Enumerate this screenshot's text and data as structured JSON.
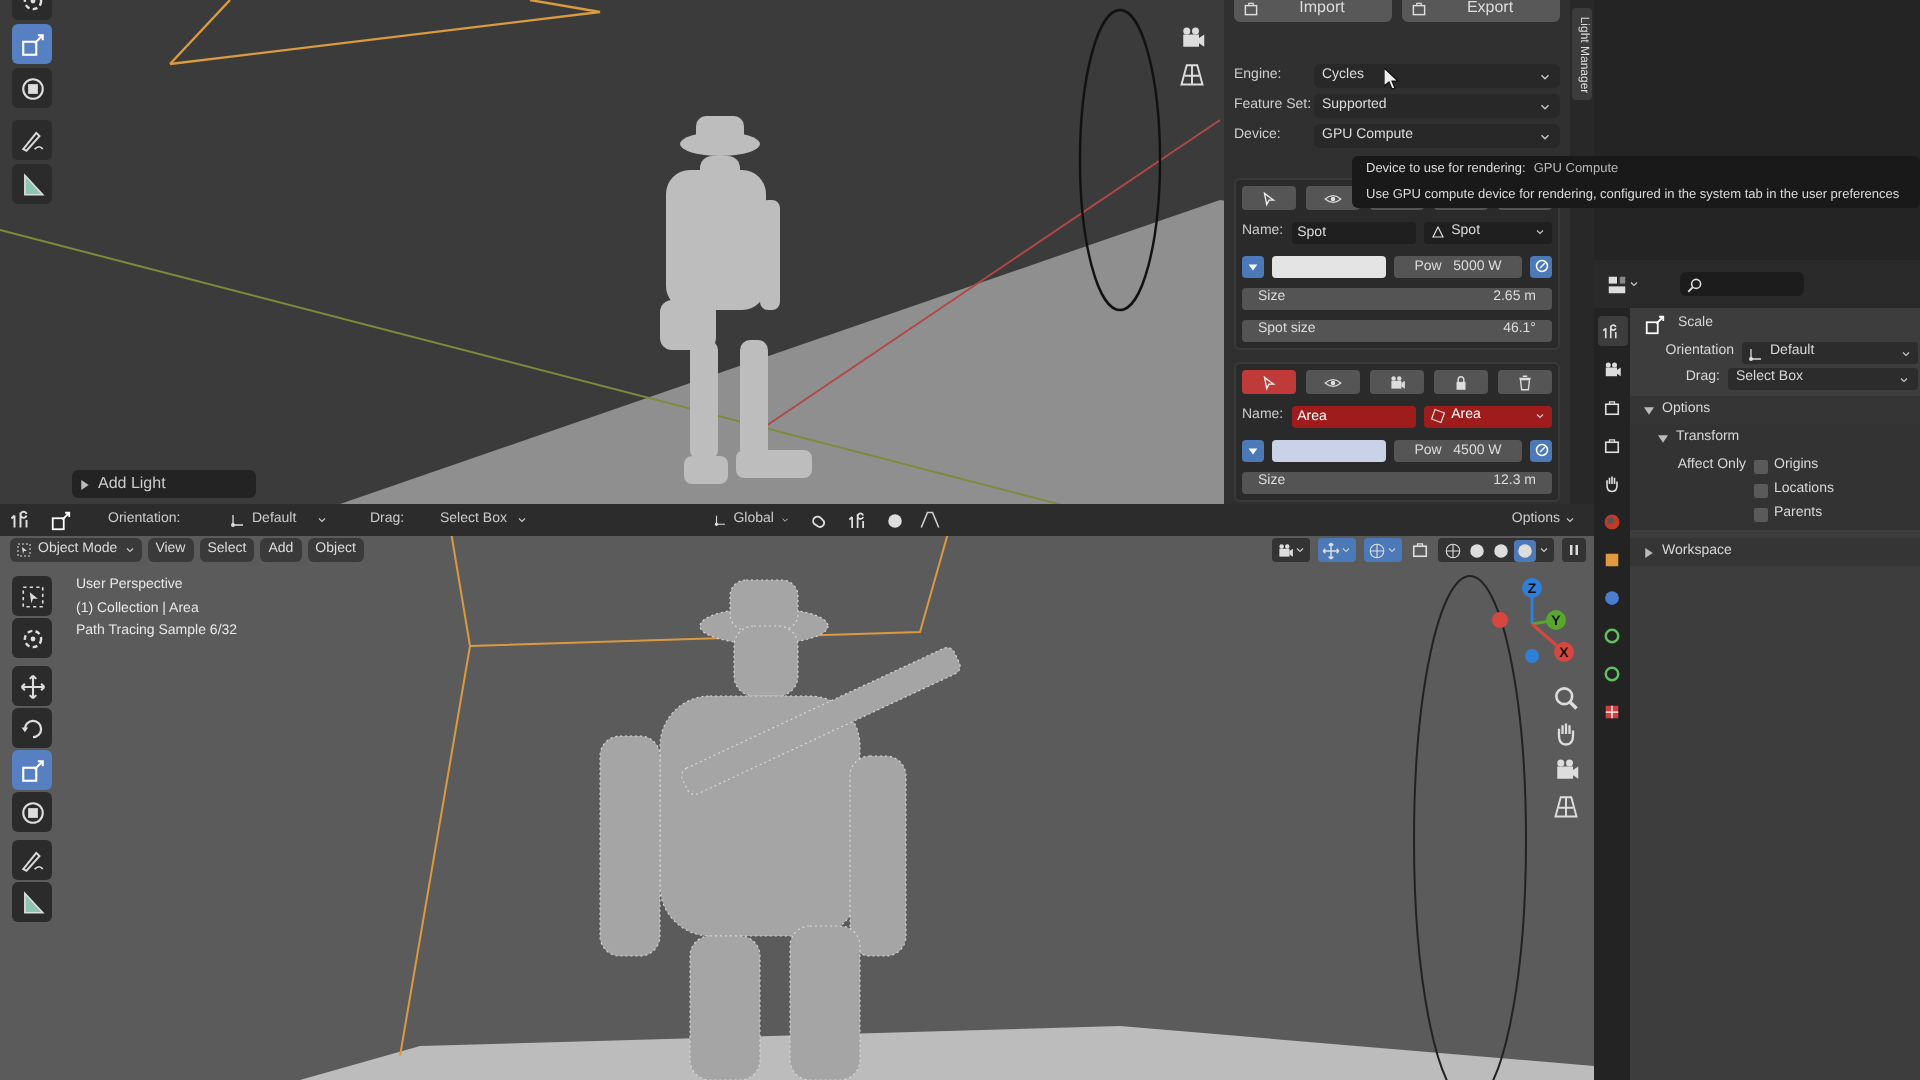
{
  "top_viewport": {
    "tools": [
      {
        "selected": false
      },
      {
        "selected": true
      },
      {
        "selected": false
      },
      {
        "selected": false
      },
      {
        "selected": false
      }
    ],
    "add_light_panel": {
      "label": "Add Light",
      "expanded": false
    }
  },
  "light_manager": {
    "tab": "Light Manager",
    "buttons": [
      "Import",
      "Export"
    ],
    "settings": [
      {
        "label": "Engine:",
        "value": "Cycles"
      },
      {
        "label": "Feature Set:",
        "value": "Supported"
      },
      {
        "label": "Device:",
        "value": "GPU Compute"
      }
    ],
    "lights": [
      {
        "selected": false,
        "name_label": "Name:",
        "name": "Spot",
        "type": "Spot",
        "color": "#e4e4e4",
        "power": "Pow   5000 W",
        "fields": [
          {
            "label": "Size",
            "value": "2.65 m"
          },
          {
            "label": "Spot size",
            "value": "46.1°"
          }
        ]
      },
      {
        "selected": true,
        "name_label": "Name:",
        "name": "Area",
        "type": "Area",
        "color": "#c9d2e6",
        "power": "Pow   4500 W",
        "fields": [
          {
            "label": "Size",
            "value": "12.3 m"
          }
        ]
      }
    ]
  },
  "tooltip": {
    "title": "Device to use for rendering:",
    "value": "GPU Compute",
    "description": "Use GPU compute device for rendering, configured in the system tab in the user preferences"
  },
  "tool_header": {
    "orientation_label": "Orientation:",
    "orientation": "Default",
    "drag_label": "Drag:",
    "drag": "Select Box",
    "transform": "Global",
    "options": "Options"
  },
  "viewport_header": {
    "mode": "Object Mode",
    "menus": [
      "View",
      "Select",
      "Add",
      "Object"
    ],
    "shading_modes": [
      {
        "selected": false
      },
      {
        "selected": false
      },
      {
        "selected": false
      },
      {
        "selected": true
      }
    ]
  },
  "viewport_info": [
    "User Perspective",
    "(1) Collection | Area",
    "Path Tracing Sample 6/32"
  ],
  "bottom_tools": [
    {
      "selected": false
    },
    {
      "selected": false
    },
    {
      "selected": false
    },
    {
      "selected": false
    },
    {
      "selected": true
    },
    {
      "selected": false
    },
    {
      "selected": false
    },
    {
      "selected": false
    }
  ],
  "gizmo_axes": [
    "Z",
    "Y",
    "X"
  ],
  "properties": {
    "tabs": [
      {
        "selected": true
      },
      {
        "selected": false
      },
      {
        "selected": false
      },
      {
        "selected": false
      },
      {
        "selected": false
      },
      {
        "selected": false
      },
      {
        "selected": false
      },
      {
        "selected": false
      },
      {
        "selected": false
      },
      {
        "selected": false
      },
      {
        "selected": false
      }
    ],
    "tool": "Scale",
    "orientation_label": "Orientation",
    "orientation": "Default",
    "drag_label": "Drag:",
    "drag": "Select Box",
    "options": {
      "label": "Options",
      "expanded": true
    },
    "transform": {
      "label": "Transform",
      "expanded": true
    },
    "affect_only": {
      "label": "Affect Only",
      "items": [
        {
          "label": "Origins",
          "checked": false
        },
        {
          "label": "Locations",
          "checked": false
        },
        {
          "label": "Parents",
          "checked": false
        }
      ]
    },
    "workspace": {
      "label": "Workspace",
      "expanded": false
    }
  }
}
